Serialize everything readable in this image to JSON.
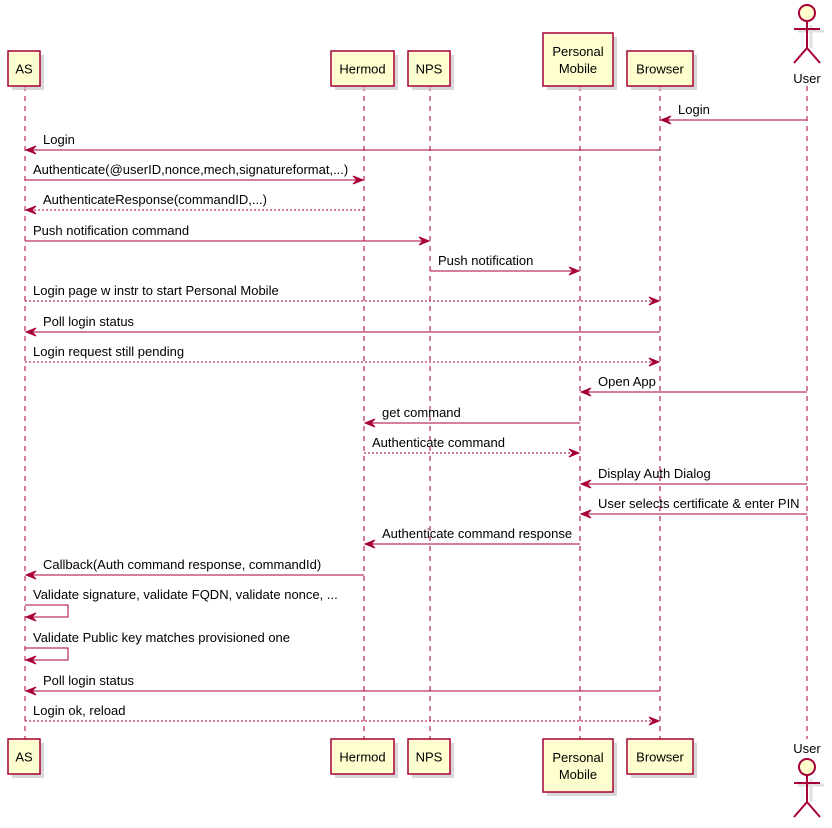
{
  "colors": {
    "border": "#A80036",
    "fill": "#FEFECE",
    "text": "#000000"
  },
  "participants": [
    {
      "id": "AS",
      "lines": [
        "AS"
      ],
      "type": "participant"
    },
    {
      "id": "Hermod",
      "lines": [
        "Hermod"
      ],
      "type": "participant"
    },
    {
      "id": "NPS",
      "lines": [
        "NPS"
      ],
      "type": "participant"
    },
    {
      "id": "PersonalMobile",
      "lines": [
        "Personal",
        "Mobile"
      ],
      "type": "participant"
    },
    {
      "id": "Browser",
      "lines": [
        "Browser"
      ],
      "type": "participant"
    },
    {
      "id": "User",
      "lines": [
        "User"
      ],
      "type": "actor"
    }
  ],
  "messages": [
    {
      "from": "User",
      "to": "Browser",
      "label": "Login",
      "style": "solid"
    },
    {
      "from": "Browser",
      "to": "AS",
      "label": "Login",
      "style": "solid"
    },
    {
      "from": "AS",
      "to": "Hermod",
      "label": "Authenticate(@userID,nonce,mech,signatureformat,...)",
      "style": "solid"
    },
    {
      "from": "Hermod",
      "to": "AS",
      "label": "AuthenticateResponse(commandID,...)",
      "style": "dashed"
    },
    {
      "from": "AS",
      "to": "NPS",
      "label": "Push notification command",
      "style": "solid"
    },
    {
      "from": "NPS",
      "to": "PersonalMobile",
      "label": "Push notification",
      "style": "solid"
    },
    {
      "from": "AS",
      "to": "Browser",
      "label": "Login page w instr to start Personal Mobile",
      "style": "dashed"
    },
    {
      "from": "Browser",
      "to": "AS",
      "label": "Poll login status",
      "style": "solid"
    },
    {
      "from": "AS",
      "to": "Browser",
      "label": "Login request still pending",
      "style": "dashed"
    },
    {
      "from": "User",
      "to": "PersonalMobile",
      "label": "Open App",
      "style": "solid"
    },
    {
      "from": "PersonalMobile",
      "to": "Hermod",
      "label": "get command",
      "style": "solid"
    },
    {
      "from": "Hermod",
      "to": "PersonalMobile",
      "label": "Authenticate command",
      "style": "dashed"
    },
    {
      "from": "User",
      "to": "PersonalMobile",
      "label": "Display Auth Dialog",
      "style": "solid"
    },
    {
      "from": "User",
      "to": "PersonalMobile",
      "label": "User selects certificate & enter PIN",
      "style": "solid"
    },
    {
      "from": "PersonalMobile",
      "to": "Hermod",
      "label": "Authenticate command response",
      "style": "solid"
    },
    {
      "from": "Hermod",
      "to": "AS",
      "label": "Callback(Auth command response, commandId)",
      "style": "solid"
    },
    {
      "from": "AS",
      "to": "AS",
      "label": "Validate signature, validate FQDN, validate nonce, ...",
      "style": "solid"
    },
    {
      "from": "AS",
      "to": "AS",
      "label": "Validate Public key matches provisioned one",
      "style": "solid"
    },
    {
      "from": "Browser",
      "to": "AS",
      "label": "Poll login status",
      "style": "solid"
    },
    {
      "from": "AS",
      "to": "Browser",
      "label": "Login ok, reload",
      "style": "dashed"
    }
  ]
}
